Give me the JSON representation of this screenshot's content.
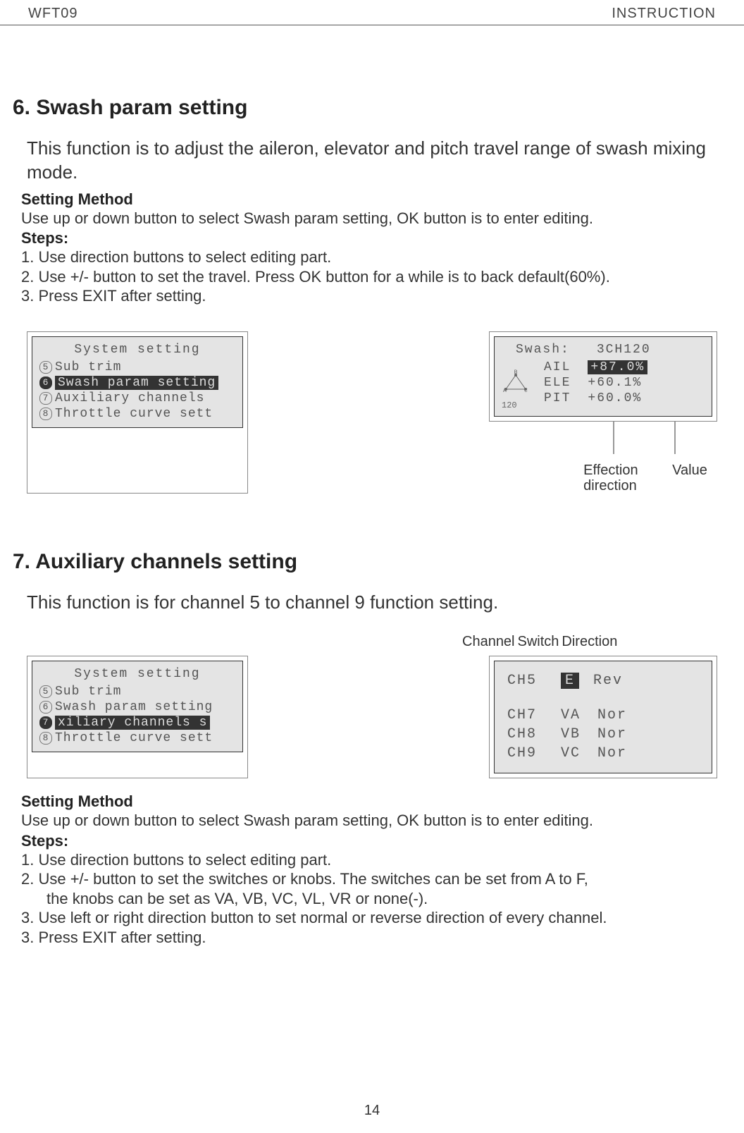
{
  "header": {
    "model": "WFT09",
    "doctype": "INSTRUCTION"
  },
  "section6": {
    "title": "6. Swash param setting",
    "intro": "This function is to adjust the aileron, elevator and pitch travel range of swash mixing mode.",
    "method_title": "Setting Method",
    "method_text": "Use up or down button to select Swash param setting, OK button is to enter editing.",
    "steps_title": "Steps:",
    "step1": "1. Use direction buttons to select editing part.",
    "step2": "2. Use +/- button to set the travel. Press OK button for a while is to back default(60%).",
    "step3": "3. Press EXIT after setting.",
    "lcd_left": {
      "title": "System setting",
      "rows": [
        {
          "num": "5",
          "text": "Sub trim",
          "selected": false
        },
        {
          "num": "6",
          "text": "Swash param setting",
          "selected": true
        },
        {
          "num": "7",
          "text": "Auxiliary channels",
          "selected": false
        },
        {
          "num": "8",
          "text": "Throttle curve sett",
          "selected": false
        }
      ]
    },
    "lcd_right": {
      "header_left": "Swash:",
      "header_right": "3CH120",
      "icon_label": "120",
      "rows": [
        {
          "name": "AIL",
          "value": "+87.0%",
          "highlight": true
        },
        {
          "name": "ELE",
          "value": "+60.1%",
          "highlight": false
        },
        {
          "name": "PIT",
          "value": "+60.0%",
          "highlight": false
        }
      ]
    },
    "pointer_labels": {
      "left": "Effection direction",
      "right": "Value"
    }
  },
  "section7": {
    "title": "7. Auxiliary channels setting",
    "intro": "This function is for channel 5 to channel 9 function setting.",
    "top_labels": {
      "channel": "Channel",
      "switch": "Switch",
      "direction": "Direction"
    },
    "lcd_left": {
      "title": "System setting",
      "rows": [
        {
          "num": "5",
          "text": "Sub trim",
          "selected": false
        },
        {
          "num": "6",
          "text": "Swash param setting",
          "selected": false
        },
        {
          "num": "7",
          "text": "xiliary channels s",
          "selected": true
        },
        {
          "num": "8",
          "text": "Throttle curve sett",
          "selected": false
        }
      ]
    },
    "lcd_right": {
      "rows": [
        {
          "ch": "CH5",
          "sw": "E",
          "dir": "Rev",
          "highlight": true
        },
        {
          "ch": "",
          "sw": "",
          "dir": "",
          "highlight": false
        },
        {
          "ch": "CH7",
          "sw": "VA",
          "dir": "Nor",
          "highlight": false
        },
        {
          "ch": "CH8",
          "sw": "VB",
          "dir": "Nor",
          "highlight": false
        },
        {
          "ch": "CH9",
          "sw": "VC",
          "dir": "Nor",
          "highlight": false
        }
      ]
    },
    "method_title": "Setting Method",
    "method_text": "Use up or down button to select Swash param setting, OK button is to enter editing.",
    "steps_title": "Steps:",
    "step1": "1. Use direction buttons to select editing part.",
    "step2": "2. Use +/- button to set the switches or knobs. The switches can be set from A to F,",
    "step2b": "the knobs can be set as VA, VB, VC, VL, VR or none(-).",
    "step3": "3. Use left or right direction button to set normal or reverse direction of every channel.",
    "step4": "3. Press EXIT after setting."
  },
  "page_number": "14"
}
